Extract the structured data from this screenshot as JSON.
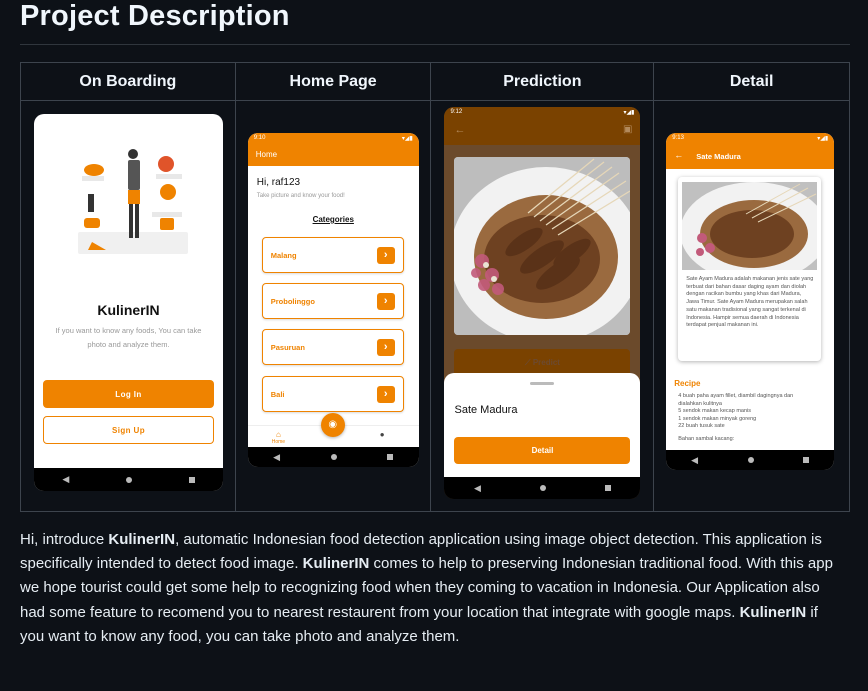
{
  "heading": "Project Description",
  "table": {
    "headers": [
      "On Boarding",
      "Home Page",
      "Prediction",
      "Detail"
    ]
  },
  "onboarding": {
    "title": "KulinerIN",
    "subtitle": "If you want to know any foods, You can take photo and analyze them.",
    "login_label": "Log In",
    "signup_label": "Sign Up"
  },
  "home": {
    "status_time": "9:10",
    "appbar_title": "Home",
    "greeting": "Hi, raf123",
    "hint": "Take picture and know your food!",
    "categories_label": "Categories",
    "cities": [
      "Malang",
      "Probolinggo",
      "Pasuruan",
      "Bali"
    ],
    "nav_home_label": "Home"
  },
  "prediction": {
    "status_time": "9:12",
    "predict_label": "Predict",
    "result_name": "Sate Madura",
    "detail_label": "Detail"
  },
  "detail": {
    "status_time": "9:13",
    "appbar_title": "Sate Madura",
    "description": "Sate Ayam Madura adalah makanan jenis sate yang terbuat dari bahan dasar daging ayam dan diolah dengan racikan bumbu yang khas dari Madura, Jawa Timur. Sate Ayam Madura merupakan salah satu makanan tradisional yang sangat terkenal di Indonesia. Hampir semua daerah di Indonesia terdapat penjual makanan ini.",
    "recipe_label": "Recipe",
    "recipe_lines": [
      "4 buah paha ayam fillet, diambil dagingnya dan",
      "dialahkan kulitnya",
      "5 sendok makan kecap manis",
      "1 sendok makan minyak goreng",
      "22 buah tusuk sate",
      "",
      "Bahan sambal kacang:"
    ]
  },
  "paragraph": {
    "p1": "Hi, introduce ",
    "b1": "KulinerIN",
    "p2": ", automatic Indonesian food detection application using image object detection. This application is specifically intended to detect food image. ",
    "b2": "KulinerIN",
    "p3": " comes to help to preserving Indonesian traditional food. With this app we hope tourist could get some help to recognizing food when they coming to vacation in Indonesia. Our Application also had some feature to recomend you to nearest restaurent from your location that integrate with google maps. ",
    "b3": "KulinerIN",
    "p4": " if you want to know any food, you can take photo and analyze them."
  },
  "colors": {
    "accent": "#ef8300",
    "background": "#0d1117",
    "border": "#3d444d"
  }
}
